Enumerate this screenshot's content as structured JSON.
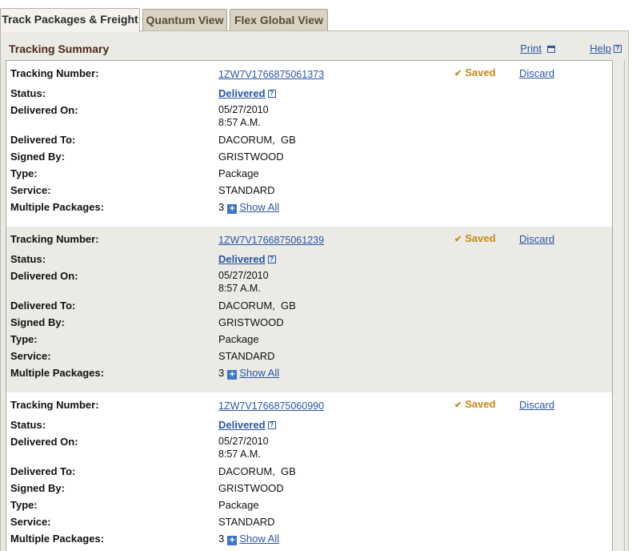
{
  "tabs": [
    {
      "label": "Track Packages & Freight",
      "active": true
    },
    {
      "label": "Quantum View",
      "active": false
    },
    {
      "label": "Flex Global View",
      "active": false
    }
  ],
  "summary": {
    "title": "Tracking Summary",
    "print_label": "Print",
    "help_label": "Help"
  },
  "labels": {
    "tracking_number": "Tracking Number:",
    "status": "Status:",
    "delivered_on": "Delivered On:",
    "delivered_to": "Delivered To:",
    "signed_by": "Signed By:",
    "type": "Type:",
    "service": "Service:",
    "multiple_packages": "Multiple Packages:"
  },
  "actions": {
    "saved_label": "Saved",
    "discard_label": "Discard",
    "show_all_label": "Show All"
  },
  "records": [
    {
      "tracking_number": "1ZW7V1766875061373",
      "status": "Delivered",
      "delivered_date": "05/27/2010",
      "delivered_time": "8:57 A.M.",
      "delivered_to": "DACORUM,  GB",
      "signed_by": "GRISTWOOD",
      "type": "Package",
      "service": "STANDARD",
      "package_count": "3"
    },
    {
      "tracking_number": "1ZW7V1766875061239",
      "status": "Delivered",
      "delivered_date": "05/27/2010",
      "delivered_time": "8:57 A.M.",
      "delivered_to": "DACORUM,  GB",
      "signed_by": "GRISTWOOD",
      "type": "Package",
      "service": "STANDARD",
      "package_count": "3"
    },
    {
      "tracking_number": "1ZW7V1766875060990",
      "status": "Delivered",
      "delivered_date": "05/27/2010",
      "delivered_time": "8:57 A.M.",
      "delivered_to": "DACORUM,  GB",
      "signed_by": "GRISTWOOD",
      "type": "Package",
      "service": "STANDARD",
      "package_count": "3"
    }
  ],
  "colors": {
    "link": "#2a57a8",
    "saved": "#c58a1a",
    "panel_bg": "#ebeae4",
    "tab_inactive_bg": "#d9d3c4"
  }
}
